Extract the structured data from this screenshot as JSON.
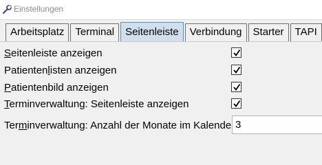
{
  "window": {
    "title": "Einstellungen"
  },
  "tabs": [
    {
      "label": "Arbeitsplatz"
    },
    {
      "label": "Terminal"
    },
    {
      "label": "Seitenleiste",
      "active": true
    },
    {
      "label": "Verbindung"
    },
    {
      "label": "Starter"
    },
    {
      "label": "TAPI"
    }
  ],
  "settings": {
    "show_sidebar": {
      "pre": "",
      "accel": "S",
      "post": "eitenleiste anzeigen",
      "checked": true
    },
    "show_patient_lists": {
      "pre": "Patienten",
      "accel": "l",
      "post": "isten anzeigen",
      "checked": true
    },
    "show_patient_image": {
      "pre": "",
      "accel": "P",
      "post": "atientenbild anzeigen",
      "checked": true
    },
    "appointment_sidebar": {
      "pre": "",
      "accel": "T",
      "post": "erminverwaltung: Seitenleiste anzeigen",
      "checked": true
    },
    "months_in_calendar": {
      "pre": "Ter",
      "accel": "m",
      "post": "inverwaltung: Anzahl der Monate im Kalender",
      "value": "3"
    }
  },
  "icons": {
    "title": "wrench-icon",
    "check": "checkmark-icon"
  }
}
